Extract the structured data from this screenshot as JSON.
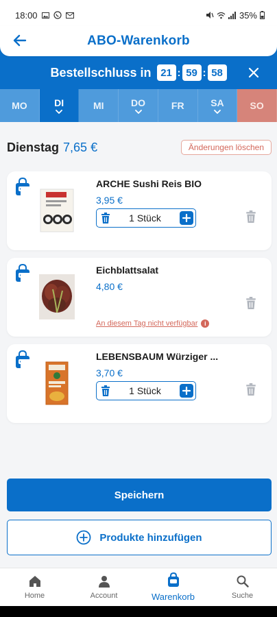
{
  "status_bar": {
    "time": "18:00",
    "battery": "35%"
  },
  "header": {
    "title": "ABO-Warenkorb"
  },
  "deadline": {
    "label": "Bestellschluss in",
    "hours": "21",
    "minutes": "59",
    "seconds": "58"
  },
  "days": [
    {
      "label": "MO",
      "active": false
    },
    {
      "label": "DI",
      "active": true
    },
    {
      "label": "MI",
      "active": false
    },
    {
      "label": "DO",
      "active": false
    },
    {
      "label": "FR",
      "active": false
    },
    {
      "label": "SA",
      "active": false
    },
    {
      "label": "SO",
      "active": false
    }
  ],
  "summary": {
    "day": "Dienstag",
    "total": "7,65 €",
    "clear_label": "Änderungen löschen"
  },
  "products": [
    {
      "name": "ARCHE Sushi Reis BIO",
      "price": "3,95 €",
      "quantity": "1 Stück"
    },
    {
      "name": "Eichblattsalat",
      "price": "4,80 €",
      "unavailable": "An diesem Tag nicht verfügbar"
    },
    {
      "name": "LEBENSBAUM Würziger ...",
      "price": "3,70 €",
      "quantity": "1 Stück"
    }
  ],
  "actions": {
    "save": "Speichern",
    "add_products": "Produkte hinzufügen"
  },
  "nav": [
    {
      "label": "Home",
      "icon": "home-icon"
    },
    {
      "label": "Account",
      "icon": "account-icon"
    },
    {
      "label": "Warenkorb",
      "icon": "basket-icon",
      "active": true
    },
    {
      "label": "Suche",
      "icon": "search-icon"
    }
  ],
  "colors": {
    "primary": "#0a6fc9",
    "day_inactive": "#4f9bdc",
    "sunday": "#d6847a",
    "warning": "#d3675a"
  }
}
